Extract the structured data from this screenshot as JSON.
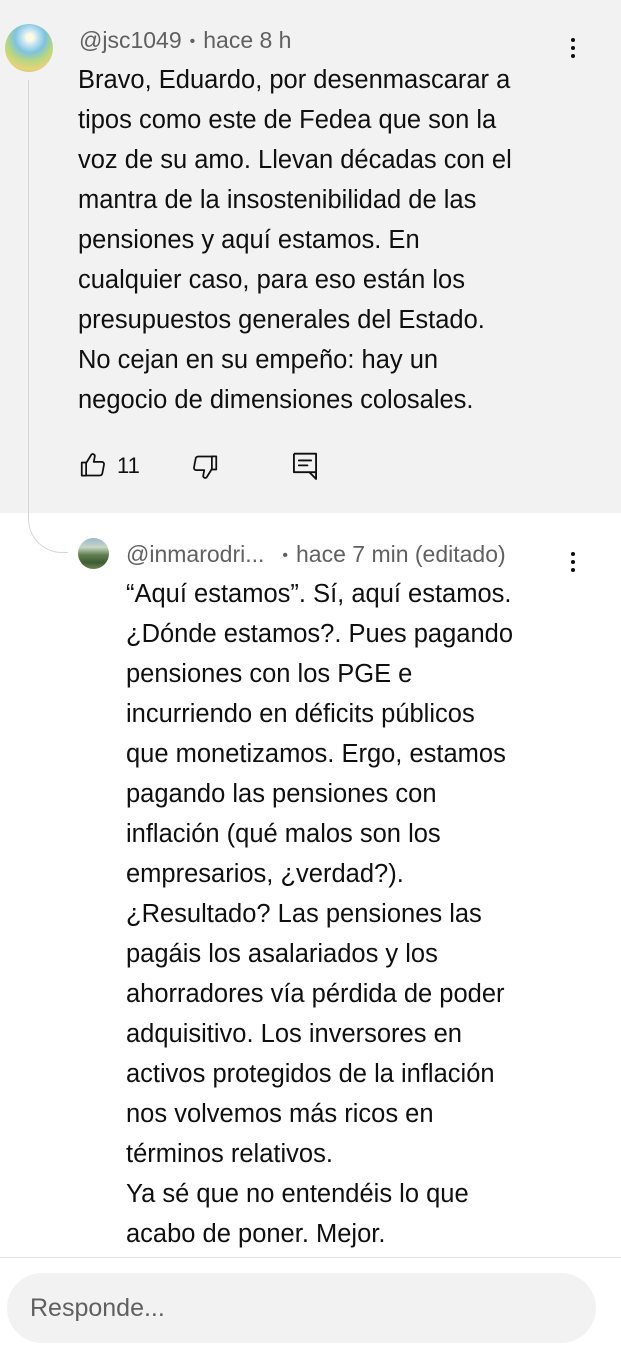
{
  "comment": {
    "author": "@jsc1049",
    "time": "hace 8 h",
    "text": "Bravo, Eduardo, por desenmascarar a\ntipos como este de Fedea que son la\nvoz de su amo. Llevan décadas con el\nmantra de la insostenibilidad de las\npensiones y aquí estamos. En\ncualquier caso, para eso están los\npresupuestos generales del Estado.\nNo cejan en su empeño: hay un\nnegocio de dimensiones colosales.",
    "like_count": "11",
    "icons": [
      "thumb-up-icon",
      "thumb-down-icon",
      "reply-icon",
      "more-vert-icon"
    ]
  },
  "reply": {
    "author": "@inmarodri...",
    "time": "hace 7 min (editado)",
    "text": "“Aquí estamos”. Sí, aquí estamos.\n¿Dónde estamos?. Pues pagando\npensiones con los PGE e\nincurriendo en déficits públicos\nque monetizamos. Ergo, estamos\npagando las pensiones con\ninflación (qué malos son los\nempresarios, ¿verdad?).\n¿Resultado? Las pensiones las\npagáis los asalariados y los\nahorradores vía pérdida de poder\nadquisitivo. Los inversores en\nactivos protegidos de la inflación\nnos volvemos más ricos en\ntérminos relativos.\nYa sé que no entendéis lo que\nacabo de poner. Mejor.",
    "icons": [
      "more-vert-icon"
    ]
  },
  "input": {
    "placeholder": "Responde..."
  },
  "colors": {
    "comment_background": "#f2f2f2",
    "secondary_text": "#606060",
    "primary_text": "#0f0f0f"
  }
}
